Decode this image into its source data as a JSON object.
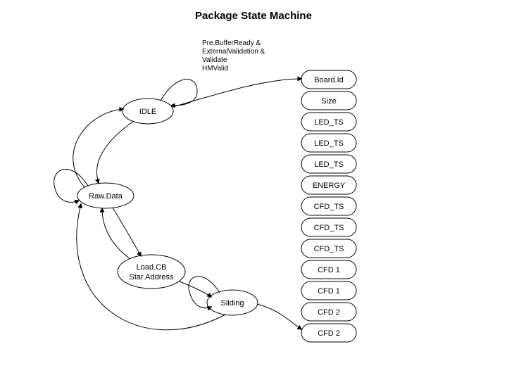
{
  "title": "Package State Machine",
  "trigger_text": "Pre.BufferReady &\nExternalValidation &\nValidate\nHMValid",
  "states": {
    "idle": "IDLE",
    "rawdata": "Raw.Data",
    "loadcb_line1": "Load.CB",
    "loadcb_line2": "Star.Address",
    "sliding": "Sliding"
  },
  "stack": [
    "Board.Id",
    "Size",
    "LED_TS",
    "LED_TS",
    "LED_TS",
    "ENERGY",
    "CFD_TS",
    "CFD_TS",
    "CFD_TS",
    "CFD 1",
    "CFD 1",
    "CFD 2",
    "CFD 2"
  ]
}
